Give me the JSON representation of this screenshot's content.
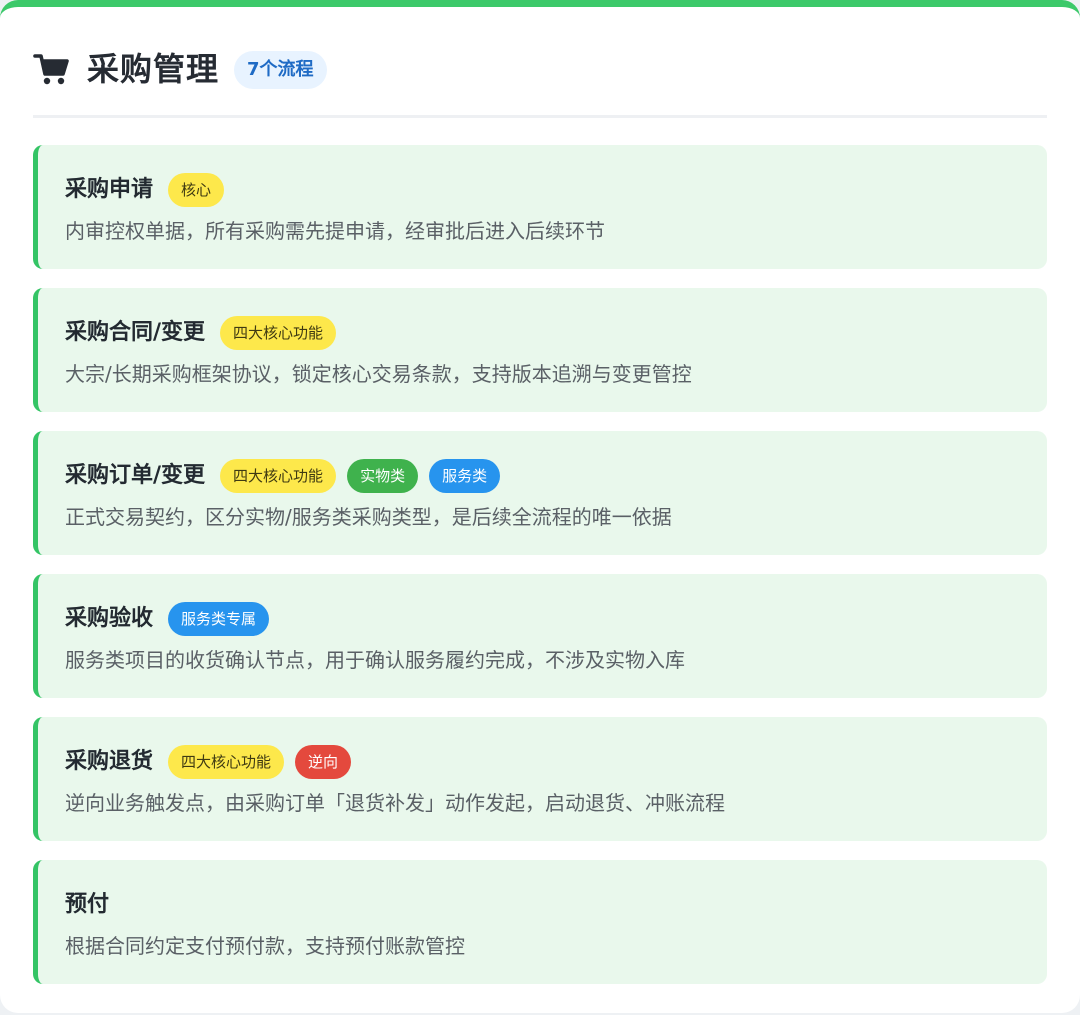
{
  "header": {
    "icon": "shopping-cart-icon",
    "title": "采购管理",
    "badge": "7个流程"
  },
  "colors": {
    "accent": "#3cc96a",
    "item_background": "#e9f8ec",
    "tag_yellow": "#fde84b",
    "tag_green": "#3fb24d",
    "tag_blue": "#2794ee",
    "tag_red": "#e4493d"
  },
  "items": [
    {
      "title": "采购申请",
      "tags": [
        {
          "label": "核心",
          "color": "yellow"
        }
      ],
      "description": "内审控权单据，所有采购需先提申请，经审批后进入后续环节"
    },
    {
      "title": "采购合同/变更",
      "tags": [
        {
          "label": "四大核心功能",
          "color": "yellow"
        }
      ],
      "description": "大宗/长期采购框架协议，锁定核心交易条款，支持版本追溯与变更管控"
    },
    {
      "title": "采购订单/变更",
      "tags": [
        {
          "label": "四大核心功能",
          "color": "yellow"
        },
        {
          "label": "实物类",
          "color": "green"
        },
        {
          "label": "服务类",
          "color": "blue"
        }
      ],
      "description": "正式交易契约，区分实物/服务类采购类型，是后续全流程的唯一依据"
    },
    {
      "title": "采购验收",
      "tags": [
        {
          "label": "服务类专属",
          "color": "blue"
        }
      ],
      "description": "服务类项目的收货确认节点，用于确认服务履约完成，不涉及实物入库"
    },
    {
      "title": "采购退货",
      "tags": [
        {
          "label": "四大核心功能",
          "color": "yellow"
        },
        {
          "label": "逆向",
          "color": "red"
        }
      ],
      "description": "逆向业务触发点，由采购订单「退货补发」动作发起，启动退货、冲账流程"
    },
    {
      "title": "预付",
      "tags": [],
      "description": "根据合同约定支付预付款，支持预付账款管控"
    }
  ]
}
